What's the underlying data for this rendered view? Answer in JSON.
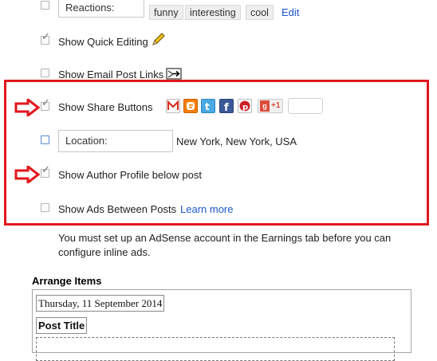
{
  "reactions": {
    "label": "Reactions:",
    "chips": [
      "funny",
      "interesting",
      "cool"
    ],
    "edit_link": "Edit"
  },
  "options": {
    "quick_editing": "Show Quick Editing",
    "email_links": "Show Email Post Links",
    "share_buttons": "Show Share Buttons",
    "location_label": "Location:",
    "location_value": "New York, New York, USA",
    "author_profile": "Show Author Profile below post",
    "ads_between": "Show Ads Between Posts",
    "learn_more": "Learn more"
  },
  "share": {
    "gplus": "+1",
    "icons": [
      "gmail-icon",
      "blogger-icon",
      "twitter-icon",
      "facebook-icon",
      "pinterest-icon",
      "google-plus-icon"
    ]
  },
  "adsense_note": {
    "line1": "You must set up an AdSense account in the Earnings tab before you can",
    "line2": "configure inline ads."
  },
  "arrange": {
    "title": "Arrange Items",
    "date": "Thursday, 11 September 2014",
    "post_title": "Post Title"
  },
  "colors": {
    "highlight": "#e3161d",
    "link": "#1a57c7"
  }
}
